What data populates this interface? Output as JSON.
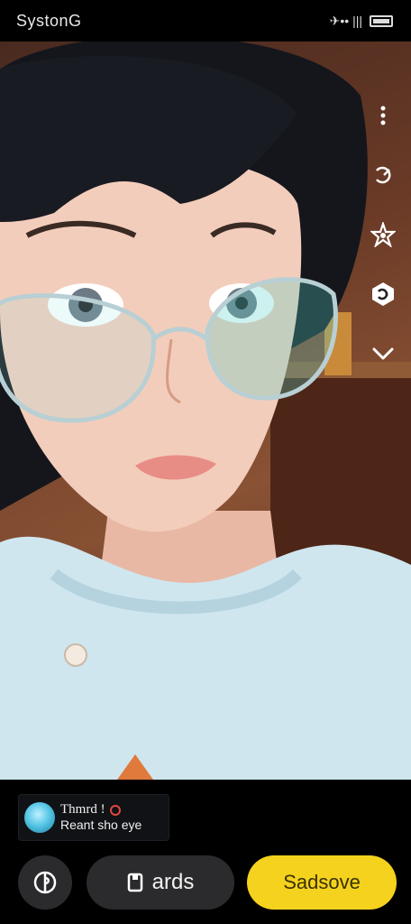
{
  "status_bar": {
    "carrier": "SystonG",
    "indicators": "✈•• |||",
    "battery_icon": "battery-icon"
  },
  "side_tools": [
    {
      "icon": "more-vertical-icon"
    },
    {
      "icon": "timer-icon"
    },
    {
      "icon": "sparkle-effects-icon"
    },
    {
      "icon": "flip-camera-icon"
    },
    {
      "icon": "chevron-down-icon"
    }
  ],
  "suggestion": {
    "line1": "Thmrd !",
    "line2": "Reant sho eye",
    "accent": "#e0483c"
  },
  "actions": {
    "mid_label": "ards",
    "save_label": "Sadsove",
    "save_color": "#f4d21d"
  }
}
